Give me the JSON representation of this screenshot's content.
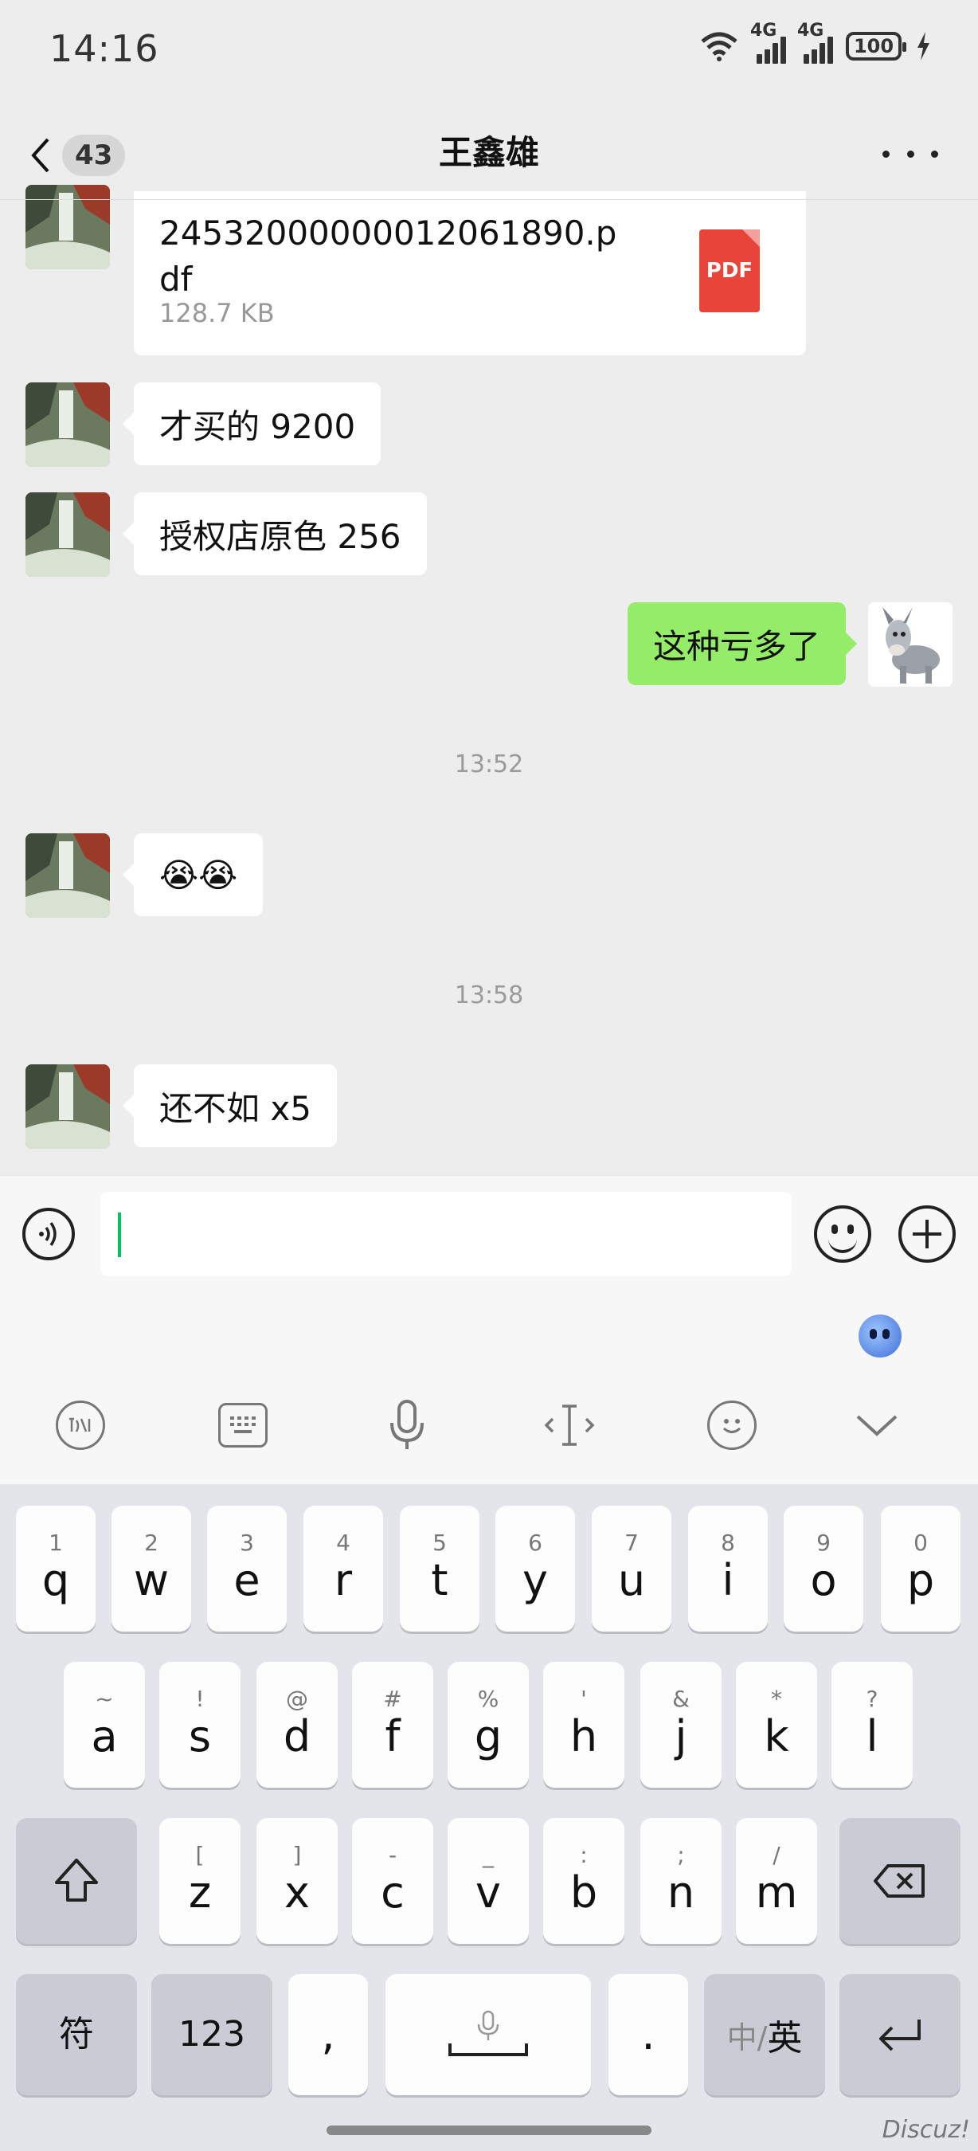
{
  "status_bar": {
    "time": "14:16",
    "network_1": "4G",
    "network_2": "4G",
    "battery": "100"
  },
  "header": {
    "unread_count": "43",
    "title": "王鑫雄"
  },
  "file_message": {
    "name": "24532000000012061890.pdf",
    "size": "128.7 KB",
    "type_label": "PDF"
  },
  "messages": [
    {
      "sender": "them",
      "text": "才买的 9200"
    },
    {
      "sender": "them",
      "text": "授权店原色 256"
    },
    {
      "sender": "me",
      "text": "这种亏多了"
    },
    {
      "sender": "them",
      "text": "😭😭"
    },
    {
      "sender": "them",
      "text": "还不如 x5"
    }
  ],
  "timestamps": [
    "13:52",
    "13:58"
  ],
  "input": {
    "value": ""
  },
  "keyboard": {
    "row1": [
      {
        "sub": "1",
        "main": "q"
      },
      {
        "sub": "2",
        "main": "w"
      },
      {
        "sub": "3",
        "main": "e"
      },
      {
        "sub": "4",
        "main": "r"
      },
      {
        "sub": "5",
        "main": "t"
      },
      {
        "sub": "6",
        "main": "y"
      },
      {
        "sub": "7",
        "main": "u"
      },
      {
        "sub": "8",
        "main": "i"
      },
      {
        "sub": "9",
        "main": "o"
      },
      {
        "sub": "0",
        "main": "p"
      }
    ],
    "row2": [
      {
        "sub": "~",
        "main": "a"
      },
      {
        "sub": "!",
        "main": "s"
      },
      {
        "sub": "@",
        "main": "d"
      },
      {
        "sub": "#",
        "main": "f"
      },
      {
        "sub": "%",
        "main": "g"
      },
      {
        "sub": "'",
        "main": "h"
      },
      {
        "sub": "&",
        "main": "j"
      },
      {
        "sub": "*",
        "main": "k"
      },
      {
        "sub": "?",
        "main": "l"
      }
    ],
    "row3": [
      {
        "sub": "[",
        "main": "z"
      },
      {
        "sub": "]",
        "main": "x"
      },
      {
        "sub": "-",
        "main": "c"
      },
      {
        "sub": "_",
        "main": "v"
      },
      {
        "sub": ":",
        "main": "b"
      },
      {
        "sub": ";",
        "main": "n"
      },
      {
        "sub": "/",
        "main": "m"
      }
    ],
    "symbols_label": "符",
    "numbers_label": "123",
    "comma_label": ",",
    "period_label": ".",
    "lang_label_inactive": "中/",
    "lang_label_active": "英"
  },
  "watermark": "Discuz!"
}
